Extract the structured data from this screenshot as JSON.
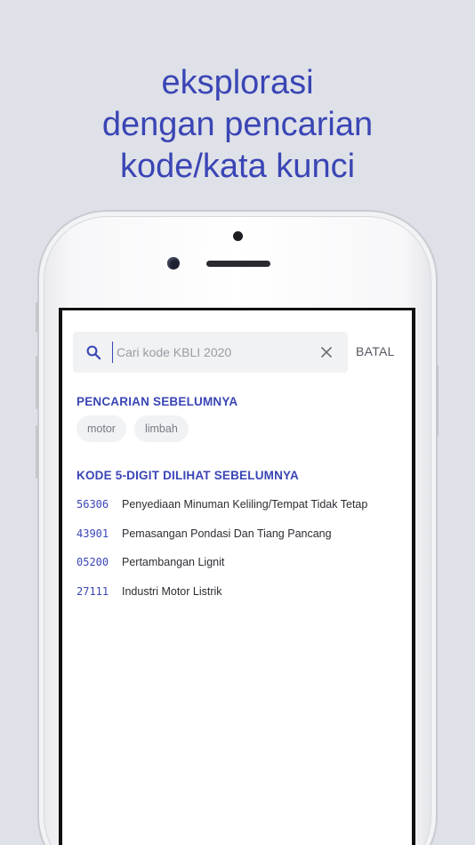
{
  "headline": {
    "line1": "eksplorasi",
    "line2": "dengan pencarian",
    "line3": "kode/kata kunci"
  },
  "search": {
    "placeholder": "Cari kode KBLI 2020",
    "value": "",
    "cancel_label": "BATAL"
  },
  "recent_searches": {
    "title": "PENCARIAN SEBELUMNYA",
    "items": [
      "motor",
      "limbah"
    ]
  },
  "recent_codes": {
    "title": "KODE 5-DIGIT DILIHAT SEBELUMNYA",
    "items": [
      {
        "code": "56306",
        "name": "Penyediaan Minuman Keliling/Tempat Tidak Tetap"
      },
      {
        "code": "43901",
        "name": "Pemasangan Pondasi Dan Tiang Pancang"
      },
      {
        "code": "05200",
        "name": "Pertambangan Lignit"
      },
      {
        "code": "27111",
        "name": "Industri Motor Listrik"
      }
    ]
  },
  "colors": {
    "accent": "#3a45b5",
    "background": "#dfe1e8"
  },
  "icons": {
    "search": "search-icon",
    "clear": "close-icon"
  }
}
